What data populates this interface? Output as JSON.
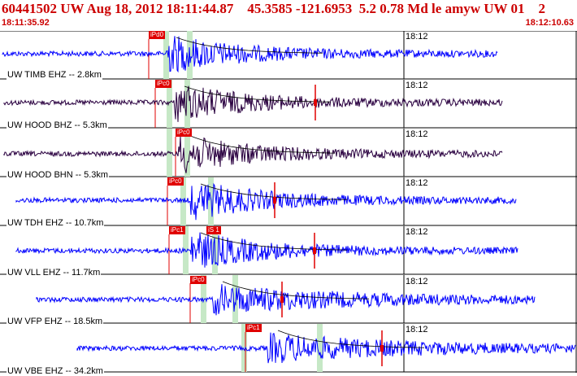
{
  "header": {
    "title": "60441502 UW Aug 18, 2012 18:11:44.87    45.3585 -121.6953  5.2 0.78 Md le amyw UW 01    2",
    "start_time": "18:11:35.92",
    "end_time": "18:12:10.63"
  },
  "colors": {
    "header_text": "#cc0000",
    "waveform": "#0000ff",
    "waveform_dark": "#2a0040",
    "pick_flag": "#e00000",
    "coda_window": "#c6e8c6",
    "separator": "#000000"
  },
  "traces": [
    {
      "label": "UW TIMB EHZ -- 2.8km",
      "time_tick": "18:12",
      "pick": "iPd0",
      "color": "#0000ff"
    },
    {
      "label": "UW HOOD BHZ -- 5.3km",
      "time_tick": "18:12",
      "pick": "iPc0",
      "color": "#2a0040"
    },
    {
      "label": "UW HOOD BHN -- 5.3km",
      "time_tick": "18:12",
      "pick": "iPc0",
      "color": "#2a0040"
    },
    {
      "label": "UW TDH EHZ -- 10.7km",
      "time_tick": "18:12",
      "pick": "iPc0",
      "color": "#0000ff"
    },
    {
      "label": "UW VLL EHZ -- 11.7km",
      "time_tick": "18:12",
      "pick": "iPc1",
      "pick2": "iS 1",
      "color": "#0000ff"
    },
    {
      "label": "UW VFP EHZ -- 18.5km",
      "time_tick": "18:12",
      "pick": "iPc0",
      "color": "#0000ff"
    },
    {
      "label": "UW VBE EHZ -- 34.2km",
      "time_tick": "18:12",
      "pick": "iPc1",
      "color": "#0000ff"
    }
  ]
}
